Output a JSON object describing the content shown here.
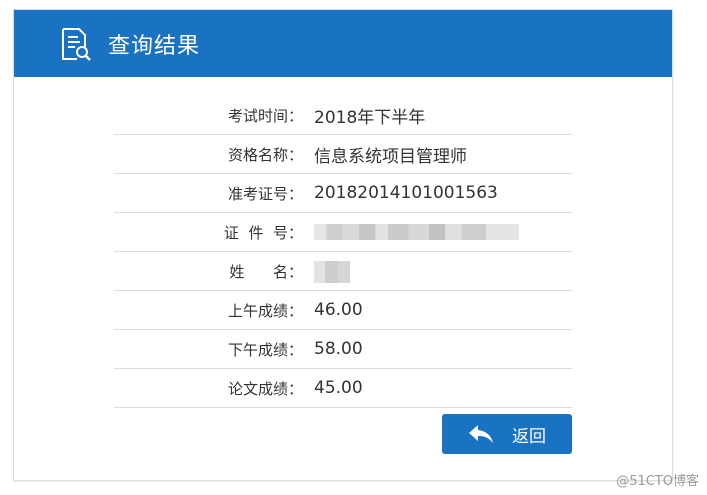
{
  "header": {
    "title": "查询结果",
    "icon": "document-search-icon",
    "background_color": "#1a72c2"
  },
  "rows": [
    {
      "label": "考试时间：",
      "value": "2018年下半年"
    },
    {
      "label": "资格名称：",
      "value": "信息系统项目管理师"
    },
    {
      "label": "准考证号：",
      "value": "20182014101001563"
    },
    {
      "label": "证  件  号：",
      "value": ""
    },
    {
      "label": "姓      名：",
      "value": ""
    },
    {
      "label": "上午成绩：",
      "value": "46.00"
    },
    {
      "label": "下午成绩：",
      "value": "58.00"
    },
    {
      "label": "论文成绩：",
      "value": "45.00"
    }
  ],
  "back_button": {
    "label": "返回",
    "icon": "reply-arrow-icon"
  },
  "watermark": "@51CTO博客"
}
